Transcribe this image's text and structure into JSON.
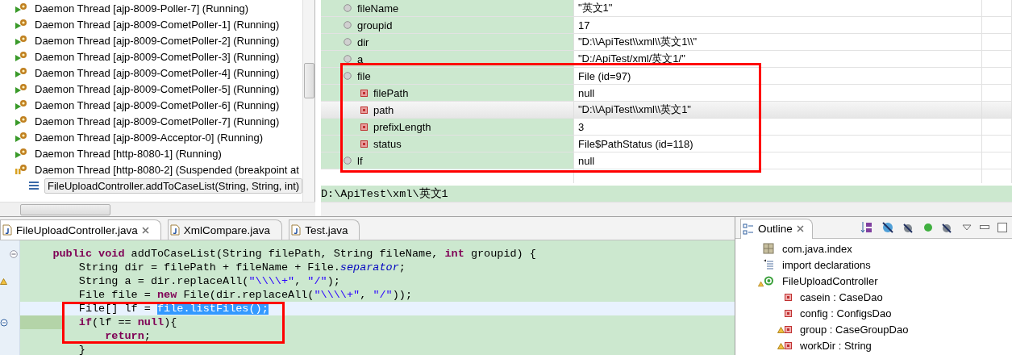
{
  "threads": [
    {
      "kind": "running",
      "label": "Daemon Thread [ajp-8009-Poller-7] (Running)",
      "selected": false
    },
    {
      "kind": "running",
      "label": "Daemon Thread [ajp-8009-CometPoller-1] (Running)",
      "selected": false
    },
    {
      "kind": "running",
      "label": "Daemon Thread [ajp-8009-CometPoller-2] (Running)",
      "selected": false
    },
    {
      "kind": "running",
      "label": "Daemon Thread [ajp-8009-CometPoller-3] (Running)",
      "selected": false
    },
    {
      "kind": "running",
      "label": "Daemon Thread [ajp-8009-CometPoller-4] (Running)",
      "selected": false
    },
    {
      "kind": "running",
      "label": "Daemon Thread [ajp-8009-CometPoller-5] (Running)",
      "selected": false
    },
    {
      "kind": "running",
      "label": "Daemon Thread [ajp-8009-CometPoller-6] (Running)",
      "selected": false
    },
    {
      "kind": "running",
      "label": "Daemon Thread [ajp-8009-CometPoller-7] (Running)",
      "selected": false
    },
    {
      "kind": "running",
      "label": "Daemon Thread [ajp-8009-Acceptor-0] (Running)",
      "selected": false
    },
    {
      "kind": "running",
      "label": "Daemon Thread [http-8080-1] (Running)",
      "selected": false
    },
    {
      "kind": "suspended",
      "label": "Daemon Thread [http-8080-2] (Suspended (breakpoint at",
      "selected": false,
      "children": [
        {
          "kind": "frame",
          "label": "FileUploadController.addToCaseList(String, String, int)",
          "selected": true
        }
      ]
    }
  ],
  "variables": {
    "rows": [
      {
        "kind": "local",
        "name": "fileName",
        "value": "\"英文1\"",
        "selected": false
      },
      {
        "kind": "local",
        "name": "groupid",
        "value": "17",
        "selected": false
      },
      {
        "kind": "local",
        "name": "dir",
        "value": "\"D:\\\\ApiTest\\\\xml\\\\英文1\\\\\"",
        "selected": false
      },
      {
        "kind": "local",
        "name": "a",
        "value": "\"D:/ApiTest/xml/英文1/\"",
        "selected": false
      },
      {
        "kind": "local",
        "name": "file",
        "value": "File  (id=97)",
        "selected": false,
        "children": [
          {
            "kind": "field",
            "name": "filePath",
            "value": "null",
            "selected": false
          },
          {
            "kind": "field",
            "name": "path",
            "value": "\"D:\\\\ApiTest\\\\xml\\\\英文1\"",
            "selected": true
          },
          {
            "kind": "field",
            "name": "prefixLength",
            "value": "3",
            "selected": false
          },
          {
            "kind": "field",
            "name": "status",
            "value": "File$PathStatus  (id=118)",
            "selected": false
          }
        ]
      },
      {
        "kind": "local",
        "name": "lf",
        "value": "null",
        "selected": false
      }
    ],
    "detail": "D:\\ApiTest\\xml\\英文1"
  },
  "editor": {
    "tabs": [
      {
        "label": "FileUploadController.java",
        "selected": true,
        "closable": true
      },
      {
        "label": "XmlCompare.java",
        "selected": false,
        "closable": false
      },
      {
        "label": "Test.java",
        "selected": false,
        "closable": false
      }
    ],
    "lines": [
      {
        "kind": "normal",
        "collapsible": true,
        "warning": false,
        "segments": [
          {
            "kind": "keyword",
            "text": "    public"
          },
          {
            "kind": "keyword",
            "text": " void"
          },
          {
            "kind": "plain",
            "text": " addToCaseList(String filePath, String fileName, "
          },
          {
            "kind": "keyword",
            "text": "int"
          },
          {
            "kind": "plain",
            "text": " groupid) {"
          }
        ]
      },
      {
        "kind": "normal",
        "collapsible": false,
        "warning": false,
        "segments": [
          {
            "kind": "plain",
            "text": "        String dir = filePath + fileName + File."
          },
          {
            "kind": "static",
            "text": "separator"
          },
          {
            "kind": "plain",
            "text": ";"
          }
        ]
      },
      {
        "kind": "normal",
        "collapsible": false,
        "warning": true,
        "segments": [
          {
            "kind": "plain",
            "text": "        String a = dir.replaceAll("
          },
          {
            "kind": "string",
            "text": "\"\\\\\\\\+\""
          },
          {
            "kind": "plain",
            "text": ", "
          },
          {
            "kind": "string",
            "text": "\"/\""
          },
          {
            "kind": "plain",
            "text": ");"
          }
        ]
      },
      {
        "kind": "normal",
        "collapsible": false,
        "warning": false,
        "segments": [
          {
            "kind": "plain",
            "text": "        File file = "
          },
          {
            "kind": "keyword",
            "text": "new"
          },
          {
            "kind": "plain",
            "text": " File(dir.replaceAll("
          },
          {
            "kind": "string",
            "text": "\"\\\\\\\\+\""
          },
          {
            "kind": "plain",
            "text": ", "
          },
          {
            "kind": "string",
            "text": "\"/\""
          },
          {
            "kind": "plain",
            "text": "));"
          }
        ]
      },
      {
        "kind": "current",
        "collapsible": false,
        "warning": false,
        "segments": [
          {
            "kind": "plain",
            "text": "        File[] lf = "
          },
          {
            "kind": "selected",
            "text": "file.listFiles();"
          }
        ]
      },
      {
        "kind": "debug",
        "collapsible": false,
        "warning": false,
        "segments": [
          {
            "kind": "keyword",
            "text": "        if"
          },
          {
            "kind": "plain",
            "text": "(lf == "
          },
          {
            "kind": "keyword",
            "text": "null"
          },
          {
            "kind": "plain",
            "text": "){"
          }
        ]
      },
      {
        "kind": "normal",
        "collapsible": false,
        "warning": false,
        "segments": [
          {
            "kind": "keyword",
            "text": "            return"
          },
          {
            "kind": "plain",
            "text": ";"
          }
        ]
      },
      {
        "kind": "normal",
        "collapsible": false,
        "warning": false,
        "segments": [
          {
            "kind": "plain",
            "text": "        }"
          }
        ]
      }
    ]
  },
  "outline": {
    "title": "Outline",
    "items": [
      {
        "kind": "package",
        "label": "com.java.index",
        "warning": false,
        "selected": false
      },
      {
        "kind": "imports",
        "label": "import declarations",
        "warning": false,
        "selected": false
      },
      {
        "kind": "class",
        "label": "FileUploadController",
        "warning": true,
        "selected": false,
        "children": [
          {
            "kind": "field",
            "label": "casein : CaseDao",
            "warning": false,
            "selected": false
          },
          {
            "kind": "field",
            "label": "config : ConfigsDao",
            "warning": false,
            "selected": false
          },
          {
            "kind": "field",
            "label": "group : CaseGroupDao",
            "warning": true,
            "selected": false
          },
          {
            "kind": "field",
            "label": "workDir : String",
            "warning": true,
            "selected": false
          }
        ]
      }
    ]
  }
}
